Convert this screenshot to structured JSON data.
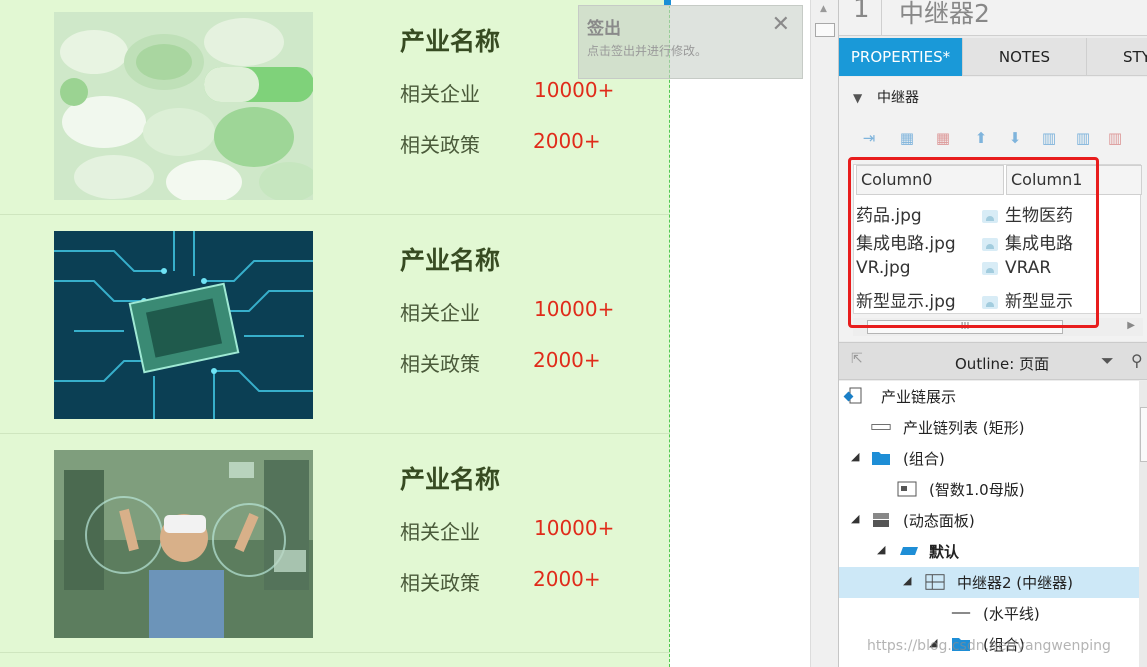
{
  "canvas": {
    "rows": [
      {
        "title": "产业名称",
        "enterprise_label": "相关企业",
        "enterprise_value": "10000+",
        "policy_label": "相关政策",
        "policy_value": "2000+",
        "image": "pills-photo"
      },
      {
        "title": "产业名称",
        "enterprise_label": "相关企业",
        "enterprise_value": "10000+",
        "policy_label": "相关政策",
        "policy_value": "2000+",
        "image": "circuit-chip-photo"
      },
      {
        "title": "产业名称",
        "enterprise_label": "相关企业",
        "enterprise_value": "10000+",
        "policy_label": "相关政策",
        "policy_value": "2000+",
        "image": "vr-headset-photo"
      }
    ],
    "background_color": "#e2f8d3",
    "value_color": "#e02b1a"
  },
  "note": {
    "title": "签出",
    "description": "点击签出并进行修改。",
    "close": "✕"
  },
  "panel": {
    "widget_number": "1",
    "widget_name": "中继器2",
    "tabs": [
      "PROPERTIES*",
      "NOTES",
      "STY"
    ],
    "section_title": "中继器",
    "grid": {
      "columns": [
        "Column0",
        "Column1"
      ],
      "rows": [
        [
          "药品.jpg",
          "生物医药"
        ],
        [
          "集成电路.jpg",
          "集成电路"
        ],
        [
          "VR.jpg",
          "VRAR"
        ],
        [
          "新型显示.jpg",
          "新型显示"
        ]
      ],
      "scroll_grip": "III"
    },
    "outline": {
      "title": "Outline: 页面",
      "items": [
        {
          "label": "产业链展示",
          "icon": "page-icon"
        },
        {
          "label": "产业链列表 (矩形)",
          "icon": "rectangle-icon"
        },
        {
          "label": "(组合)",
          "icon": "folder-icon"
        },
        {
          "label": "(智数1.0母版)",
          "icon": "master-icon"
        },
        {
          "label": "(动态面板)",
          "icon": "dynamic-panel-icon"
        },
        {
          "label": "默认",
          "icon": "state-icon"
        },
        {
          "label": "中继器2 (中继器)",
          "icon": "repeater-icon"
        },
        {
          "label": "(水平线)",
          "icon": "line-icon"
        },
        {
          "label": "(组合)",
          "icon": "folder-icon"
        }
      ]
    }
  },
  "watermark": "https://blog.csdn.net/yangwenping"
}
